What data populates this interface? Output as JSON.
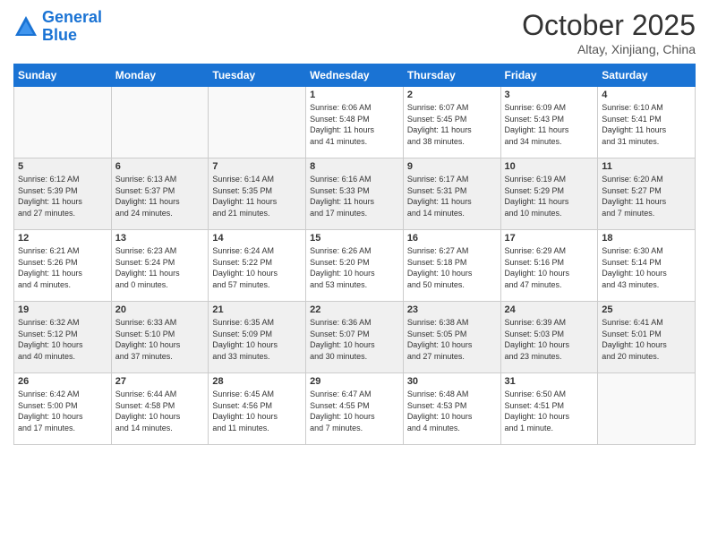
{
  "header": {
    "logo_line1": "General",
    "logo_line2": "Blue",
    "month": "October 2025",
    "location": "Altay, Xinjiang, China"
  },
  "weekdays": [
    "Sunday",
    "Monday",
    "Tuesday",
    "Wednesday",
    "Thursday",
    "Friday",
    "Saturday"
  ],
  "weeks": [
    [
      {
        "day": "",
        "info": ""
      },
      {
        "day": "",
        "info": ""
      },
      {
        "day": "",
        "info": ""
      },
      {
        "day": "1",
        "info": "Sunrise: 6:06 AM\nSunset: 5:48 PM\nDaylight: 11 hours\nand 41 minutes."
      },
      {
        "day": "2",
        "info": "Sunrise: 6:07 AM\nSunset: 5:45 PM\nDaylight: 11 hours\nand 38 minutes."
      },
      {
        "day": "3",
        "info": "Sunrise: 6:09 AM\nSunset: 5:43 PM\nDaylight: 11 hours\nand 34 minutes."
      },
      {
        "day": "4",
        "info": "Sunrise: 6:10 AM\nSunset: 5:41 PM\nDaylight: 11 hours\nand 31 minutes."
      }
    ],
    [
      {
        "day": "5",
        "info": "Sunrise: 6:12 AM\nSunset: 5:39 PM\nDaylight: 11 hours\nand 27 minutes."
      },
      {
        "day": "6",
        "info": "Sunrise: 6:13 AM\nSunset: 5:37 PM\nDaylight: 11 hours\nand 24 minutes."
      },
      {
        "day": "7",
        "info": "Sunrise: 6:14 AM\nSunset: 5:35 PM\nDaylight: 11 hours\nand 21 minutes."
      },
      {
        "day": "8",
        "info": "Sunrise: 6:16 AM\nSunset: 5:33 PM\nDaylight: 11 hours\nand 17 minutes."
      },
      {
        "day": "9",
        "info": "Sunrise: 6:17 AM\nSunset: 5:31 PM\nDaylight: 11 hours\nand 14 minutes."
      },
      {
        "day": "10",
        "info": "Sunrise: 6:19 AM\nSunset: 5:29 PM\nDaylight: 11 hours\nand 10 minutes."
      },
      {
        "day": "11",
        "info": "Sunrise: 6:20 AM\nSunset: 5:27 PM\nDaylight: 11 hours\nand 7 minutes."
      }
    ],
    [
      {
        "day": "12",
        "info": "Sunrise: 6:21 AM\nSunset: 5:26 PM\nDaylight: 11 hours\nand 4 minutes."
      },
      {
        "day": "13",
        "info": "Sunrise: 6:23 AM\nSunset: 5:24 PM\nDaylight: 11 hours\nand 0 minutes."
      },
      {
        "day": "14",
        "info": "Sunrise: 6:24 AM\nSunset: 5:22 PM\nDaylight: 10 hours\nand 57 minutes."
      },
      {
        "day": "15",
        "info": "Sunrise: 6:26 AM\nSunset: 5:20 PM\nDaylight: 10 hours\nand 53 minutes."
      },
      {
        "day": "16",
        "info": "Sunrise: 6:27 AM\nSunset: 5:18 PM\nDaylight: 10 hours\nand 50 minutes."
      },
      {
        "day": "17",
        "info": "Sunrise: 6:29 AM\nSunset: 5:16 PM\nDaylight: 10 hours\nand 47 minutes."
      },
      {
        "day": "18",
        "info": "Sunrise: 6:30 AM\nSunset: 5:14 PM\nDaylight: 10 hours\nand 43 minutes."
      }
    ],
    [
      {
        "day": "19",
        "info": "Sunrise: 6:32 AM\nSunset: 5:12 PM\nDaylight: 10 hours\nand 40 minutes."
      },
      {
        "day": "20",
        "info": "Sunrise: 6:33 AM\nSunset: 5:10 PM\nDaylight: 10 hours\nand 37 minutes."
      },
      {
        "day": "21",
        "info": "Sunrise: 6:35 AM\nSunset: 5:09 PM\nDaylight: 10 hours\nand 33 minutes."
      },
      {
        "day": "22",
        "info": "Sunrise: 6:36 AM\nSunset: 5:07 PM\nDaylight: 10 hours\nand 30 minutes."
      },
      {
        "day": "23",
        "info": "Sunrise: 6:38 AM\nSunset: 5:05 PM\nDaylight: 10 hours\nand 27 minutes."
      },
      {
        "day": "24",
        "info": "Sunrise: 6:39 AM\nSunset: 5:03 PM\nDaylight: 10 hours\nand 23 minutes."
      },
      {
        "day": "25",
        "info": "Sunrise: 6:41 AM\nSunset: 5:01 PM\nDaylight: 10 hours\nand 20 minutes."
      }
    ],
    [
      {
        "day": "26",
        "info": "Sunrise: 6:42 AM\nSunset: 5:00 PM\nDaylight: 10 hours\nand 17 minutes."
      },
      {
        "day": "27",
        "info": "Sunrise: 6:44 AM\nSunset: 4:58 PM\nDaylight: 10 hours\nand 14 minutes."
      },
      {
        "day": "28",
        "info": "Sunrise: 6:45 AM\nSunset: 4:56 PM\nDaylight: 10 hours\nand 11 minutes."
      },
      {
        "day": "29",
        "info": "Sunrise: 6:47 AM\nSunset: 4:55 PM\nDaylight: 10 hours\nand 7 minutes."
      },
      {
        "day": "30",
        "info": "Sunrise: 6:48 AM\nSunset: 4:53 PM\nDaylight: 10 hours\nand 4 minutes."
      },
      {
        "day": "31",
        "info": "Sunrise: 6:50 AM\nSunset: 4:51 PM\nDaylight: 10 hours\nand 1 minute."
      },
      {
        "day": "",
        "info": ""
      }
    ]
  ]
}
